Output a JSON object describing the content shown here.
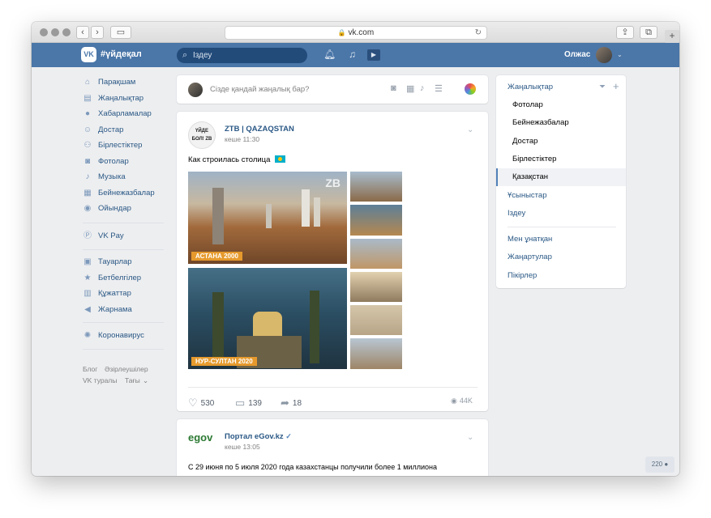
{
  "browser": {
    "url": "vk.com"
  },
  "header": {
    "brand": "#үйдеқал",
    "logo": "VK",
    "search_placeholder": "Іздеу",
    "user_name": "Олжас"
  },
  "sidebar": {
    "items": [
      {
        "label": "Парақшам",
        "icon": "home-icon"
      },
      {
        "label": "Жаңалықтар",
        "icon": "news-icon"
      },
      {
        "label": "Хабарламалар",
        "icon": "messages-icon"
      },
      {
        "label": "Достар",
        "icon": "friend-icon"
      },
      {
        "label": "Бірлестіктер",
        "icon": "groups-icon"
      },
      {
        "label": "Фотолар",
        "icon": "camera-icon"
      },
      {
        "label": "Музыка",
        "icon": "music-icon"
      },
      {
        "label": "Бейнежазбалар",
        "icon": "video-icon"
      },
      {
        "label": "Ойындар",
        "icon": "gamepad-icon"
      }
    ],
    "pay": {
      "label": "VK Pay",
      "icon": "vkpay-icon"
    },
    "items2": [
      {
        "label": "Тауарлар",
        "icon": "bag-icon"
      },
      {
        "label": "Бетбелгілер",
        "icon": "star-icon"
      },
      {
        "label": "Құжаттар",
        "icon": "document-icon"
      },
      {
        "label": "Жарнама",
        "icon": "megaphone-icon"
      }
    ],
    "corona": {
      "label": "Коронавирус",
      "icon": "virus-icon"
    },
    "footer": {
      "blog": "Блог",
      "devs": "Әзірлеушілер",
      "about": "VK туралы",
      "more": "Тағы"
    }
  },
  "composer": {
    "placeholder": "Сізде қандай жаңалық бар?"
  },
  "post1": {
    "author": "ZTB | QAZAQSTAN",
    "time": "кеше 11:30",
    "avatar_text": "ҮЙДЕ БОЛ! ZB",
    "text": "Как строилась столица",
    "photo_top_caption": "АСТАНА 2000",
    "photo_bottom_caption": "НУР-СУЛТАН 2020",
    "photo_logo": "ZB",
    "likes": "530",
    "comments": "139",
    "shares": "18",
    "views": "44K"
  },
  "post2": {
    "logo": "egov",
    "author": "Портал eGov.kz",
    "time": "кеше 13:05",
    "text": "С 29 июня по 5 июля 2020 года казахстанцы получили более 1 миллиона"
  },
  "right_nav": {
    "title": "Жаңалықтар",
    "subitems": [
      "Фотолар",
      "Бейнежазбалар",
      "Достар",
      "Бірлестіктер",
      "Қазақстан"
    ],
    "items": [
      "Ұсыныстар",
      "Іздеу"
    ],
    "items2": [
      "Мен ұнатқан",
      "Жаңартулар",
      "Пікірлер"
    ]
  },
  "online_count": "220",
  "colors": {
    "vk_blue": "#4a76a8",
    "link": "#2a5885",
    "background": "#edeef0"
  }
}
